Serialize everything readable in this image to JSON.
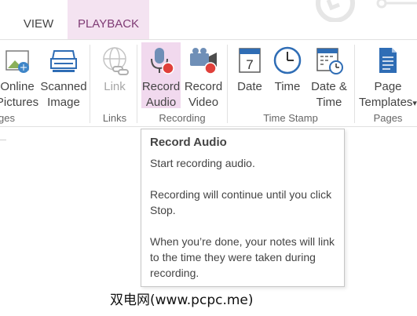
{
  "tabs": [
    {
      "label": "VIEW",
      "active": false
    },
    {
      "label": "PLAYBACK",
      "active": true
    }
  ],
  "ribbon": {
    "buttons": {
      "online_pictures": {
        "label_1": "Online",
        "label_2": "Pictures",
        "icon": "online-pictures-icon"
      },
      "scanned_image": {
        "label_1": "Scanned",
        "label_2": "Image",
        "icon": "scanner-icon"
      },
      "link": {
        "label_1": "Link",
        "icon": "link-globe-icon",
        "disabled": true
      },
      "record_audio": {
        "label_1": "Record",
        "label_2": "Audio",
        "icon": "microphone-icon",
        "active": true
      },
      "record_video": {
        "label_1": "Record",
        "label_2": "Video",
        "icon": "video-camera-icon"
      },
      "date": {
        "label_1": "Date",
        "icon": "calendar-icon"
      },
      "time": {
        "label_1": "Time",
        "icon": "clock-icon"
      },
      "date_time": {
        "label_1": "Date &",
        "label_2": "Time",
        "icon": "calendar-clock-icon"
      },
      "page_templates": {
        "label_1": "Page",
        "label_2": "Templates",
        "icon": "page-template-icon"
      }
    },
    "groups": {
      "images": "ges",
      "links": "Links",
      "recording": "Recording",
      "time_stamp": "Time Stamp",
      "pages": "Pages"
    }
  },
  "tooltip": {
    "title": "Record Audio",
    "line1": "Start recording audio.",
    "line2": "Recording will continue until you click Stop.",
    "line3": "When you’re done, your notes will link to the time they were taken during recording."
  },
  "watermark": "双电网(www.pcpc.me)",
  "colors": {
    "accent": "#7f3b75",
    "active_tab_bg": "#f4e3f1",
    "active_button_bg": "#f1d9ee",
    "record_red": "#e0403a",
    "icon_blue": "#2f6db5"
  }
}
